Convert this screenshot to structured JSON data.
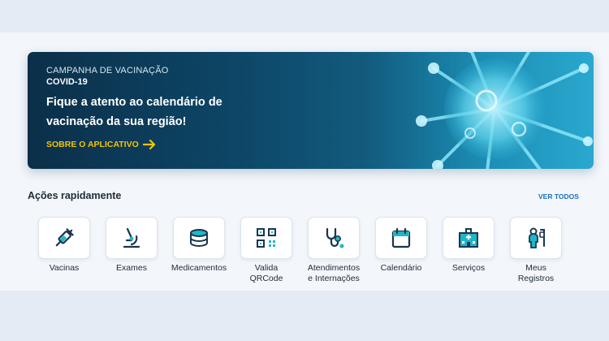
{
  "banner": {
    "kicker": "CAMPANHA DE VACINAÇÃO",
    "subtitle": "COVID-19",
    "title": "Fique a atento ao calendário de vacinação da sua região!",
    "link_label": "SOBRE O APLICATIVO",
    "link_color": "#f4c400"
  },
  "quick_actions": {
    "title": "Ações rapidamente",
    "see_all": "VER TODOS",
    "items": [
      {
        "label": "Vacinas",
        "icon": "syringe-icon"
      },
      {
        "label": "Exames",
        "icon": "microscope-icon"
      },
      {
        "label": "Medicamentos",
        "icon": "pill-icon"
      },
      {
        "label": "Valida\nQRCode",
        "icon": "qrcode-icon"
      },
      {
        "label": "Atendimentos\ne Internações",
        "icon": "stethoscope-icon"
      },
      {
        "label": "Calendário",
        "icon": "calendar-icon"
      },
      {
        "label": "Serviços",
        "icon": "hospital-icon"
      },
      {
        "label": "Meus\nRegistros",
        "icon": "patient-icon"
      }
    ]
  },
  "colors": {
    "icon_dark": "#1a3550",
    "icon_accent": "#1fb7c7"
  }
}
